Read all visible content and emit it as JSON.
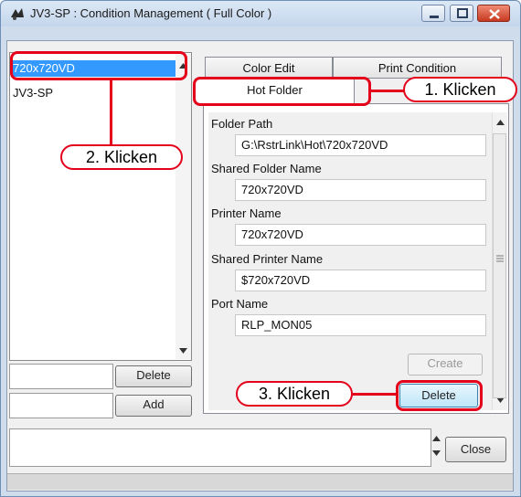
{
  "window": {
    "title": "JV3-SP : Condition Management ( Full Color )",
    "controls": [
      "minimize",
      "maximize",
      "close"
    ]
  },
  "list": {
    "items": [
      "720x720VD",
      "JV3-SP"
    ],
    "selected_index": 0,
    "delete_label": "Delete",
    "add_label": "Add"
  },
  "tabs": [
    {
      "label": "Color Edit"
    },
    {
      "label": "Print Condition"
    },
    {
      "label": "Hot Folder"
    }
  ],
  "hot_folder": {
    "fields": [
      {
        "label": "Folder Path",
        "value": "G:\\RstrLink\\Hot\\720x720VD"
      },
      {
        "label": "Shared Folder Name",
        "value": "720x720VD"
      },
      {
        "label": "Printer Name",
        "value": "720x720VD"
      },
      {
        "label": "Shared Printer Name",
        "value": "$720x720VD"
      },
      {
        "label": "Port Name",
        "value": "RLP_MON05"
      }
    ],
    "create_label": "Create",
    "delete_label": "Delete"
  },
  "footer": {
    "close_label": "Close"
  },
  "callouts": {
    "step1": "1. Klicken",
    "step2": "2. Klicken",
    "step3": "3. Klicken"
  },
  "colors": {
    "highlight": "#e4001b",
    "selection": "#3399ff"
  }
}
